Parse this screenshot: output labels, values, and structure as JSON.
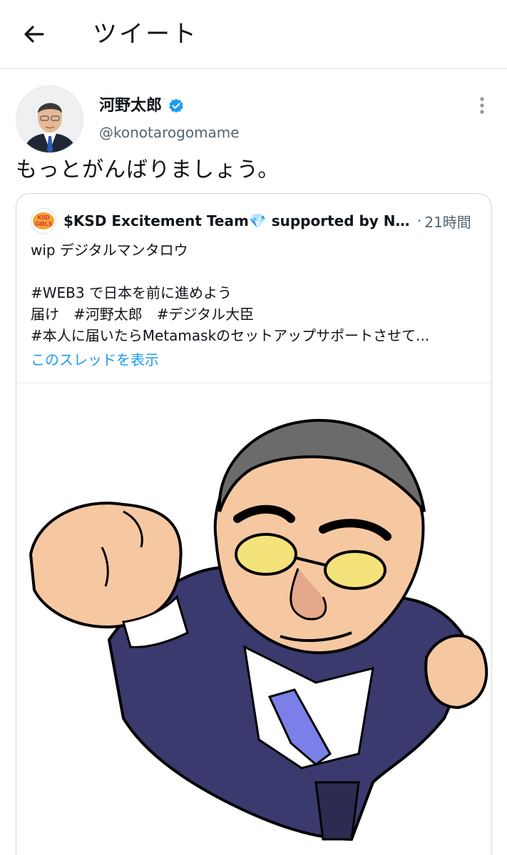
{
  "header": {
    "title": "ツイート",
    "back_icon": "arrow-left-icon"
  },
  "tweet": {
    "author_name": "河野太郎",
    "author_handle": "@konotarogomame",
    "verified_icon": "verified-badge-icon",
    "more_icon": "more-vertical-icon",
    "text": "もっとがんばりましょう。"
  },
  "quote": {
    "author_name": "$KSD Excitement Team💎 supported by NAN...",
    "separator": "·",
    "time": "21時間",
    "logo_text_top": "KSD",
    "logo_text_bottom": "GIRLS",
    "lines": [
      "wip デジタルマンタロウ",
      "",
      "#WEB3 で日本を前に進めよう",
      "届け　#河野太郎　#デジタル大臣",
      "#本人に届いたらMetamaskのセットアップサポートさせて..."
    ],
    "show_thread": "このスレッドを表示"
  },
  "colors": {
    "accent": "#1d9bf0",
    "secondary_text": "#536471",
    "border": "#cfd9de",
    "suit": "#3a3a6e",
    "skin": "#f6c8a2",
    "hair": "#6b6b6b",
    "tie": "#7b80e8",
    "glasses": "#f4e27a"
  }
}
